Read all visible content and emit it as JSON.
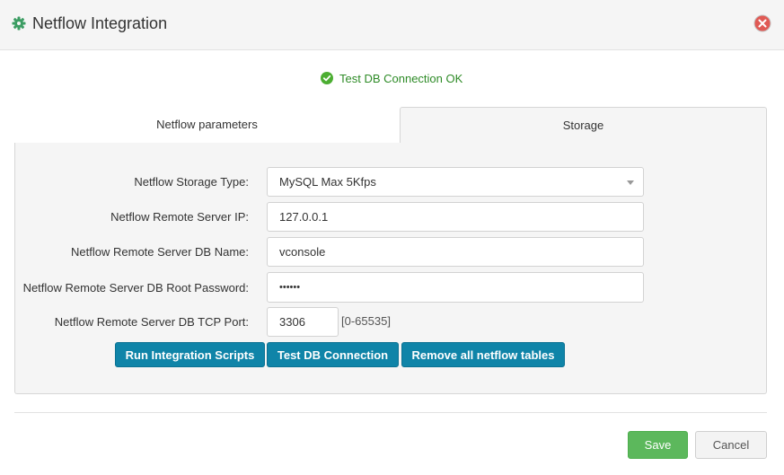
{
  "dialog": {
    "title": "Netflow Integration",
    "icon": "gear-icon",
    "close_icon": "close-icon"
  },
  "status": {
    "icon": "check-circle-icon",
    "text": "Test DB Connection OK",
    "color": "#2e8b27"
  },
  "tabs": [
    {
      "label": "Netflow parameters",
      "active": false
    },
    {
      "label": "Storage",
      "active": true
    }
  ],
  "form": {
    "storage_type_label": "Netflow Storage Type:",
    "storage_type_value": "MySQL Max 5Kfps",
    "server_ip_label": "Netflow Remote Server IP:",
    "server_ip_value": "127.0.0.1",
    "db_name_label": "Netflow Remote Server DB Name:",
    "db_name_value": "vconsole",
    "root_password_label": "Netflow Remote Server DB Root Password:",
    "root_password_value": "••••••",
    "tcp_port_label": "Netflow Remote Server DB TCP Port:",
    "tcp_port_value": "3306",
    "tcp_port_hint": "[0-65535]"
  },
  "actions": {
    "run_scripts": "Run Integration Scripts",
    "test_connection": "Test DB Connection",
    "remove_tables": "Remove all netflow tables"
  },
  "footer": {
    "save": "Save",
    "cancel": "Cancel"
  },
  "colors": {
    "primary_button": "#0f84a8",
    "save_button": "#5cb85c",
    "gear_icon": "#3c9d63",
    "close_icon": "#d9534f"
  }
}
